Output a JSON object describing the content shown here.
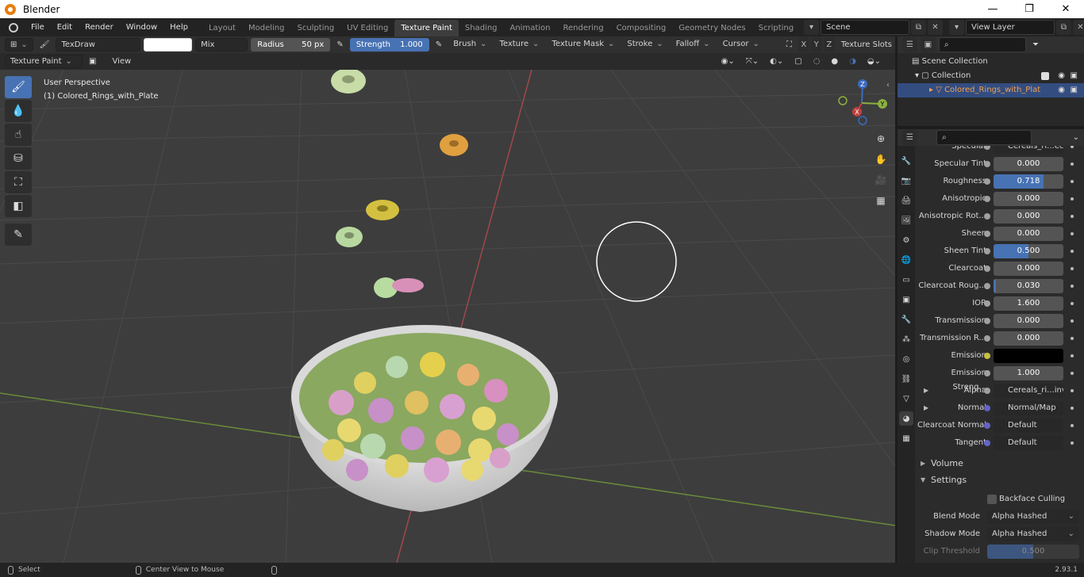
{
  "window": {
    "title": "Blender",
    "minimize": "—",
    "maximize": "❐",
    "close": "✕"
  },
  "menu": [
    "File",
    "Edit",
    "Render",
    "Window",
    "Help"
  ],
  "workspaces": [
    {
      "label": "Layout",
      "active": false
    },
    {
      "label": "Modeling",
      "active": false
    },
    {
      "label": "Sculpting",
      "active": false
    },
    {
      "label": "UV Editing",
      "active": false
    },
    {
      "label": "Texture Paint",
      "active": true
    },
    {
      "label": "Shading",
      "active": false
    },
    {
      "label": "Animation",
      "active": false
    },
    {
      "label": "Rendering",
      "active": false
    },
    {
      "label": "Compositing",
      "active": false
    },
    {
      "label": "Geometry Nodes",
      "active": false
    },
    {
      "label": "Scripting",
      "active": false
    }
  ],
  "scene": {
    "name": "Scene",
    "view_layer": "View Layer"
  },
  "toolheader": {
    "brush_name": "TexDraw",
    "blend": "Mix",
    "radius_label": "Radius",
    "radius_value": "50 px",
    "strength_label": "Strength",
    "strength_value": "1.000",
    "menus": [
      "Brush",
      "Texture",
      "Texture Mask",
      "Stroke",
      "Falloff",
      "Cursor"
    ],
    "axes": [
      "X",
      "Y",
      "Z"
    ],
    "texture_slots": "Texture Slots"
  },
  "modeheader": {
    "mode": "Texture Paint",
    "view": "View"
  },
  "viewport": {
    "perspective": "User Perspective",
    "object": "(1) Colored_Rings_with_Plate",
    "gizmo": {
      "x": "X",
      "y": "Y",
      "z": "Z"
    }
  },
  "outliner": {
    "scene_collection": "Scene Collection",
    "collection": "Collection",
    "object": "Colored_Rings_with_Plat"
  },
  "properties": {
    "rows": [
      {
        "label": "Specular",
        "type": "link",
        "value": "Cereals_ri...ecular.png",
        "dot": "grey"
      },
      {
        "label": "Specular Tint",
        "type": "num",
        "value": "0.000",
        "fill": 0
      },
      {
        "label": "Roughness",
        "type": "num",
        "value": "0.718",
        "fill": 0.718
      },
      {
        "label": "Anisotropic",
        "type": "num",
        "value": "0.000",
        "fill": 0
      },
      {
        "label": "Anisotropic Rot...",
        "type": "num",
        "value": "0.000",
        "fill": 0
      },
      {
        "label": "Sheen",
        "type": "num",
        "value": "0.000",
        "fill": 0
      },
      {
        "label": "Sheen Tint",
        "type": "num",
        "value": "0.500",
        "fill": 0.5
      },
      {
        "label": "Clearcoat",
        "type": "num",
        "value": "0.000",
        "fill": 0
      },
      {
        "label": "Clearcoat Roug...",
        "type": "num",
        "value": "0.030",
        "fill": 0.03
      },
      {
        "label": "IOR",
        "type": "num",
        "value": "1.600",
        "fill": 0
      },
      {
        "label": "Transmission",
        "type": "num",
        "value": "0.000",
        "fill": 0
      },
      {
        "label": "Transmission R...",
        "type": "num",
        "value": "0.000",
        "fill": 0
      },
      {
        "label": "Emission",
        "type": "color",
        "value": "",
        "dot": "yellow",
        "color": "#000000"
      },
      {
        "label": "Emission Streng...",
        "type": "num",
        "value": "1.000",
        "fill": 0
      },
      {
        "label": "Alpha",
        "type": "link",
        "value": "Cereals_ri...invert.png",
        "dot": "grey",
        "expand": true
      },
      {
        "label": "Normal",
        "type": "link",
        "value": "Normal/Map",
        "dot": "purple",
        "expand": true
      },
      {
        "label": "Clearcoat Normal",
        "type": "link",
        "value": "Default",
        "dot": "purple"
      },
      {
        "label": "Tangent",
        "type": "link",
        "value": "Default",
        "dot": "purple"
      }
    ],
    "volume": "Volume",
    "settings": "Settings",
    "backface": "Backface Culling",
    "blend_mode_label": "Blend Mode",
    "blend_mode": "Alpha Hashed",
    "shadow_mode_label": "Shadow Mode",
    "shadow_mode": "Alpha Hashed",
    "clip_label": "Clip Threshold",
    "clip_value": "0.500"
  },
  "status": {
    "select": "Select",
    "center": "Center View to Mouse",
    "version": "2.93.1"
  },
  "colors": {
    "accent": "#4772b3",
    "selected_object": "#f0a050"
  }
}
